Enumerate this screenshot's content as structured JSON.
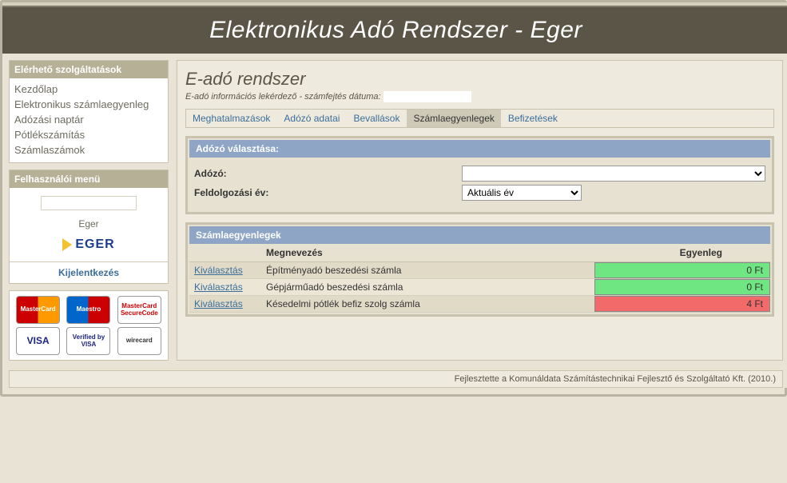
{
  "header": {
    "title": "Elektronikus Adó Rendszer - Eger"
  },
  "sidebar": {
    "services_title": "Elérhető szolgáltatások",
    "items": [
      {
        "label": "Kezdőlap"
      },
      {
        "label": "Elektronikus számlaegyenleg"
      },
      {
        "label": "Adózási naptár"
      },
      {
        "label": "Pótlékszámítás"
      },
      {
        "label": "Számlaszámok"
      }
    ],
    "user_title": "Felhasználói menü",
    "city": "Eger",
    "logo_text": "EGER",
    "logout": "Kijelentkezés"
  },
  "cards": {
    "mastercard": "MasterCard",
    "maestro": "Maestro",
    "securecode": "MasterCard SecureCode",
    "visa": "VISA",
    "vbv": "Verified by VISA",
    "wirecard": "wirecard"
  },
  "main": {
    "heading": "E-adó rendszer",
    "subline_prefix": "E-adó információs lekérdező - számfejtés dátuma:",
    "tabs": [
      {
        "label": "Meghatalmazások"
      },
      {
        "label": "Adózó adatai"
      },
      {
        "label": "Bevallások"
      },
      {
        "label": "Számlaegyenlegek",
        "active": true
      },
      {
        "label": "Befizetések"
      }
    ]
  },
  "selector_panel": {
    "title": "Adózó választása:",
    "field_adozo": "Adózó:",
    "field_year": "Feldolgozási év:",
    "year_value": "Aktuális év"
  },
  "balances_panel": {
    "title": "Számlaegyenlegek",
    "col_select": "",
    "col_name": "Megnevezés",
    "col_balance": "Egyenleg",
    "select_label": "Kiválasztás",
    "rows": [
      {
        "name": "Építményadó beszedési számla",
        "balance": "0 Ft",
        "color": "green"
      },
      {
        "name": "Gépjárműadó beszedési számla",
        "balance": "0 Ft",
        "color": "green"
      },
      {
        "name": "Késedelmi pótlék befiz szolg számla",
        "balance": "4 Ft",
        "color": "red"
      }
    ]
  },
  "footer": {
    "text": "Fejlesztette a Komunáldata Számítástechnikai Fejlesztő és Szolgáltató Kft. (2010.)"
  }
}
